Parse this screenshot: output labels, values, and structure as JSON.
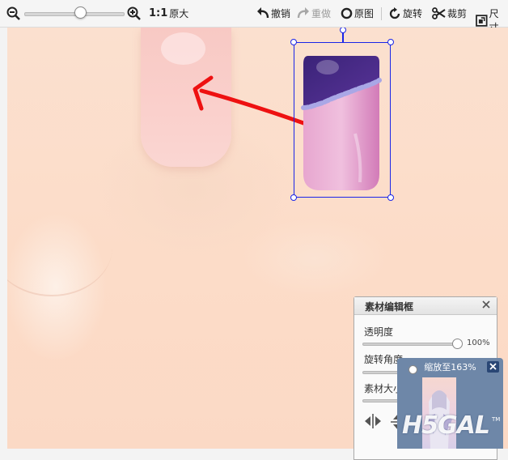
{
  "toolbar": {
    "zoom_out_icon": "zoom-out-icon",
    "zoom_in_icon": "zoom-in-icon",
    "ratio_label": "1:1",
    "original_size_label": "原大",
    "undo_label": "撤销",
    "redo_label": "重做",
    "original_image_label": "原图",
    "rotate_label": "旋转",
    "crop_label": "裁剪",
    "size_label": "尺寸"
  },
  "material_panel": {
    "title": "素材编辑框",
    "opacity_label": "透明度",
    "opacity_value": "100%",
    "rotation_label": "旋转角度",
    "size_label": "素材大小"
  },
  "zoom_preview": {
    "zoom_text": "缩放至163%",
    "watermark": "H5GAL",
    "watermark_tm": "TM"
  },
  "colors": {
    "selection": "#1a25e8",
    "arrow": "#ee1111",
    "skin": "#fcdcc8",
    "nail_purple": "#4a2a8a",
    "nail_pink": "#d27bb8"
  }
}
